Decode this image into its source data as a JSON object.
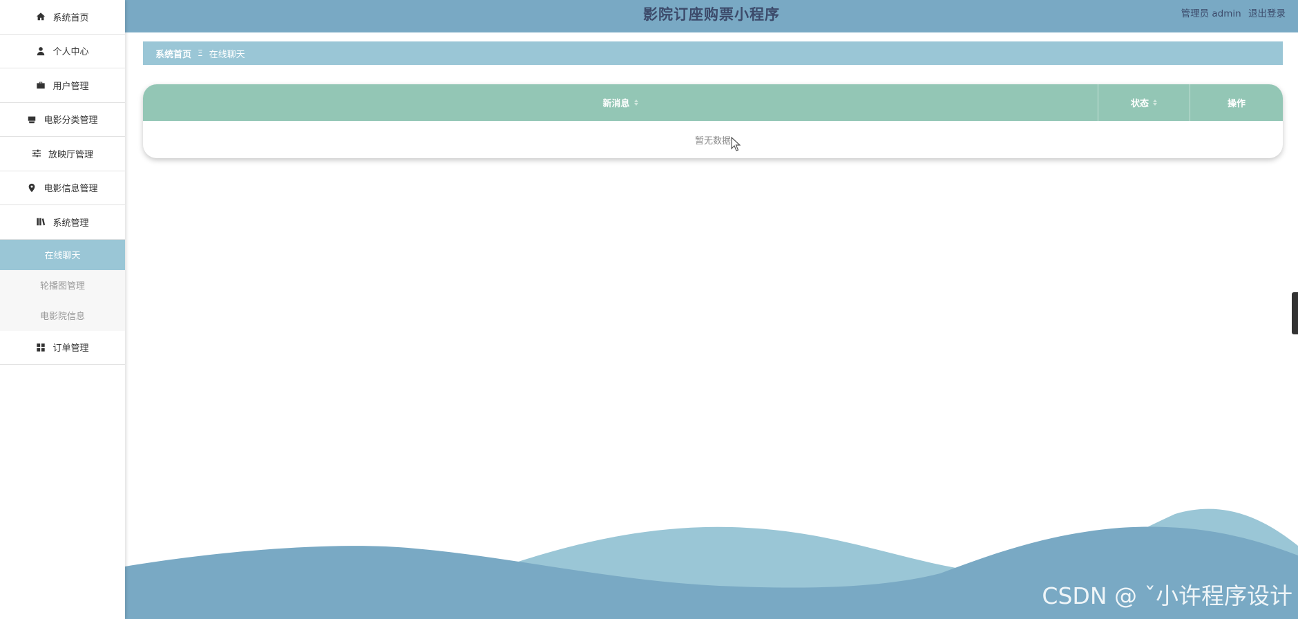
{
  "app": {
    "title": "影院订座购票小程序",
    "user_label": "管理员 admin",
    "logout_label": "退出登录"
  },
  "sidebar": {
    "items": [
      {
        "label": "系统首页",
        "icon": "home-icon"
      },
      {
        "label": "个人中心",
        "icon": "user-icon"
      },
      {
        "label": "用户管理",
        "icon": "briefcase-icon"
      },
      {
        "label": "电影分类管理",
        "icon": "inbox-icon"
      },
      {
        "label": "放映厅管理",
        "icon": "sliders-icon"
      },
      {
        "label": "电影信息管理",
        "icon": "map-pin-icon"
      },
      {
        "label": "系统管理",
        "icon": "library-icon"
      }
    ],
    "submenu": [
      {
        "label": "在线聊天",
        "active": true
      },
      {
        "label": "轮播图管理",
        "active": false
      },
      {
        "label": "电影院信息",
        "active": false
      }
    ],
    "last_item": {
      "label": "订单管理",
      "icon": "grid-icon"
    }
  },
  "breadcrumb": {
    "home": "系统首页",
    "separator": "Ξ",
    "current": "在线聊天"
  },
  "table": {
    "columns": [
      {
        "label": "新消息",
        "sortable": true
      },
      {
        "label": "状态",
        "sortable": true
      },
      {
        "label": "操作",
        "sortable": false
      }
    ],
    "empty_text": "暂无数据"
  },
  "watermark": "CSDN @ ˇ小许程序设计",
  "colors": {
    "header": "#79a9c4",
    "breadcrumb": "#9ac6d6",
    "table_head": "#93c6b5",
    "wave_light": "#9ac6d6",
    "wave_dark": "#79a9c4"
  }
}
